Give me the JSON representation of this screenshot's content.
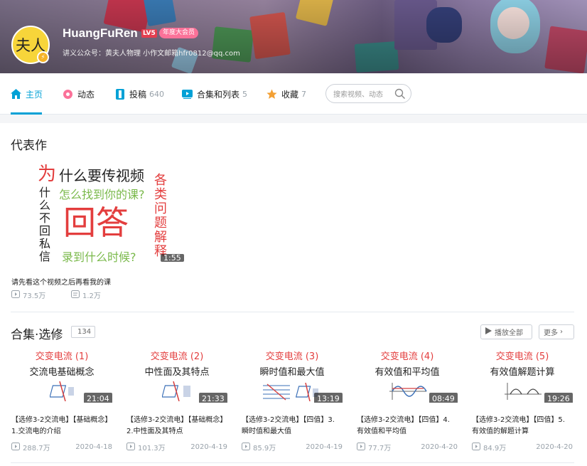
{
  "header": {
    "username": "HuangFuRen",
    "level": "LV5",
    "badge": "年度大会员",
    "signature": "讲义公众号：黄夫人物理 小作文邮箱hfr0812@qq.com",
    "avatar_text": "夫人"
  },
  "nav": {
    "tabs": [
      {
        "label": "主页",
        "count": ""
      },
      {
        "label": "动态",
        "count": ""
      },
      {
        "label": "投稿",
        "count": "640"
      },
      {
        "label": "合集和列表",
        "count": "5"
      },
      {
        "label": "收藏",
        "count": "7"
      }
    ],
    "search_placeholder": "搜索视频、动态"
  },
  "representative": {
    "heading": "代表作",
    "thumb_lines": {
      "wei": "为",
      "line1": "什么要传视频",
      "line2": "怎么找到你的课?",
      "big": "回答",
      "line3": "录到什么时候?",
      "vertical_left": "什么不回私信",
      "vertical_right": "各类问题解释"
    },
    "duration": "1:55",
    "title": "请先看这个视频之后再看我的课",
    "views": "73.5万",
    "danmaku": "1.2万"
  },
  "collection": {
    "title": "合集·选修",
    "count": "134",
    "play_all": "播放全部",
    "more": "更多",
    "videos": [
      {
        "red": "交变电流 (1)",
        "topic": "交流电基础概念",
        "duration": "21:04",
        "title": "【选修3-2交流电】【基础概念】1.交流电的介绍",
        "views": "288.7万",
        "date": "2020-4-18"
      },
      {
        "red": "交变电流 (2)",
        "topic": "中性面及其特点",
        "duration": "21:33",
        "title": "【选修3-2交流电】【基础概念】2.中性面及其特点",
        "views": "101.3万",
        "date": "2020-4-19"
      },
      {
        "red": "交变电流 (3)",
        "topic": "瞬时值和最大值",
        "duration": "13:19",
        "title": "【选修3-2交流电】【四值】3.瞬时值和最大值",
        "views": "85.9万",
        "date": "2020-4-19"
      },
      {
        "red": "交变电流 (4)",
        "topic": "有效值和平均值",
        "duration": "08:49",
        "title": "【选修3-2交流电】【四值】4.有效值和平均值",
        "views": "77.7万",
        "date": "2020-4-20"
      },
      {
        "red": "交变电流 (5)",
        "topic": "有效值解题计算",
        "duration": "19:26",
        "title": "【选修3-2交流电】【四值】5.有效值的解题计算",
        "views": "84.9万",
        "date": "2020-4-20"
      }
    ]
  },
  "colors": {
    "accent": "#00a1d6",
    "red": "#e33e3e",
    "green": "#7ab94b",
    "pink": "#fb7299"
  }
}
